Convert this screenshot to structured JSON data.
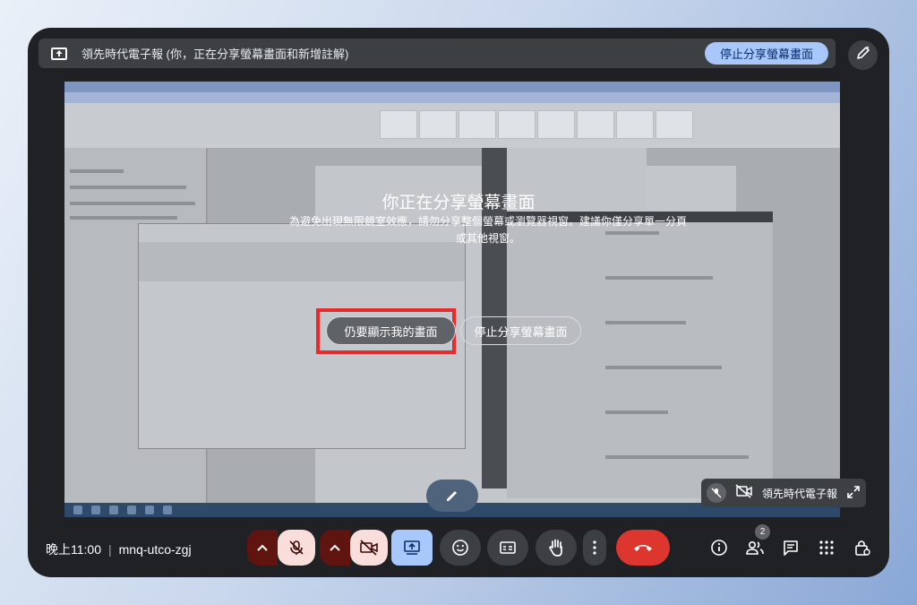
{
  "topbar": {
    "title": "領先時代電子報 (你，正在分享螢幕畫面和新增註解)",
    "stop_label": "停止分享螢幕畫面"
  },
  "dialog": {
    "title": "你正在分享螢幕畫面",
    "body_line1": "為避免出現無限鏡室效應，請勿分享整個螢幕或瀏覽器視窗。建議你僅分享單一分頁",
    "body_line2": "或其他視窗。",
    "show_label": "仍要顯示我的畫面",
    "stop_label": "停止分享螢幕畫面"
  },
  "self_tile": {
    "name": "領先時代電子報"
  },
  "meeting": {
    "time": "晚上11:00",
    "code": "mnq-utco-zgj"
  },
  "participants": {
    "count": "2"
  },
  "colors": {
    "accent": "#a8c7fa",
    "leave": "#dc362e",
    "muted_bg": "#f9dedc",
    "muted_chevron": "#601410",
    "highlight": "#e52b2b"
  },
  "icons": [
    "present-screen-icon",
    "pen-annotate-icon",
    "mic-off-icon",
    "camera-off-icon",
    "chevron-up-icon",
    "present-icon",
    "emoji-icon",
    "captions-icon",
    "raise-hand-icon",
    "more-vert-icon",
    "call-end-icon",
    "info-icon",
    "people-icon",
    "chat-icon",
    "activities-icon",
    "host-controls-icon",
    "expand-icon",
    "sparkle-icon"
  ]
}
